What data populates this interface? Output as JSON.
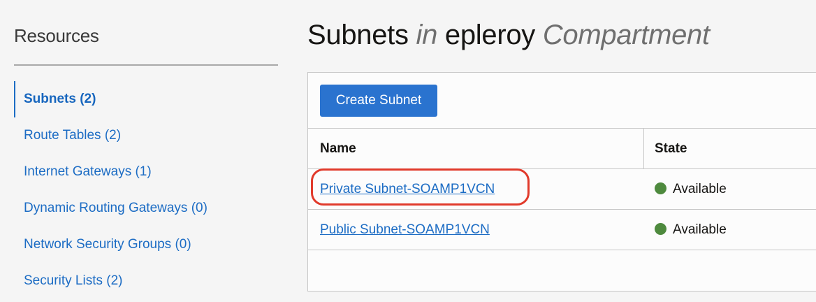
{
  "sidebar": {
    "title": "Resources",
    "items": [
      {
        "label": "Subnets (2)",
        "active": true
      },
      {
        "label": "Route Tables (2)",
        "active": false
      },
      {
        "label": "Internet Gateways (1)",
        "active": false
      },
      {
        "label": "Dynamic Routing Gateways (0)",
        "active": false
      },
      {
        "label": "Network Security Groups (0)",
        "active": false
      },
      {
        "label": "Security Lists (2)",
        "active": false
      }
    ]
  },
  "main": {
    "heading": {
      "part1": "Subnets",
      "part2": "in",
      "part3": "epleroy",
      "part4": "Compartment"
    },
    "create_button_label": "Create Subnet",
    "table": {
      "columns": [
        "Name",
        "State"
      ],
      "rows": [
        {
          "name": "Private Subnet-SOAMP1VCN",
          "state": "Available",
          "highlighted": true
        },
        {
          "name": "Public Subnet-SOAMP1VCN",
          "state": "Available",
          "highlighted": false
        }
      ]
    }
  },
  "colors": {
    "link": "#1c6cc4",
    "primary_button": "#2a73cf",
    "status_available": "#4e8a3e",
    "highlight": "#e13a2b"
  }
}
